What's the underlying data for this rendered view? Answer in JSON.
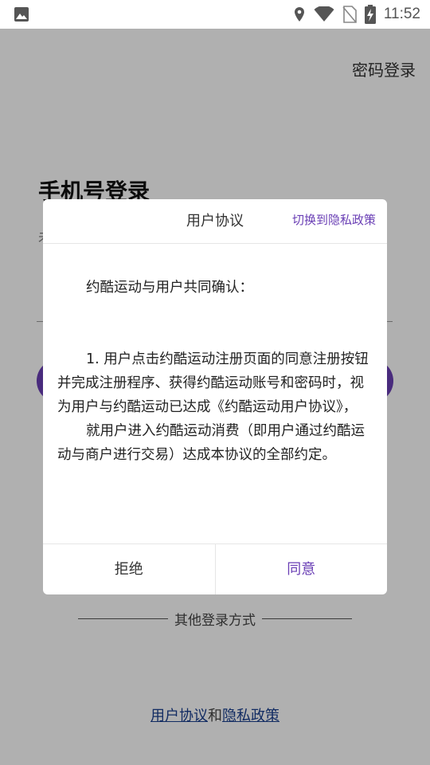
{
  "status_bar": {
    "time": "11:52",
    "icons": [
      "gallery-icon",
      "location-icon",
      "wifi-icon",
      "no-sim-icon",
      "battery-charging-icon"
    ]
  },
  "login": {
    "password_login": "密码登录",
    "title": "手机号登录",
    "subtitle_visible": "未",
    "other_methods": "其他登录方式",
    "agreement_user": "用户协议",
    "agreement_and": "和",
    "agreement_privacy": "隐私政策"
  },
  "colors": {
    "accent": "#6a3fb5",
    "link": "#1a3f8f"
  },
  "dialog": {
    "title": "用户协议",
    "switch_label": "切换到隐私政策",
    "confirm": "约酷运动与用户共同确认：",
    "paragraph1": "1. 用户点击约酷运动注册页面的同意注册按钮并完成注册程序、获得约酷运动账号和密码时，视为用户与约酷运动已达成《约酷运动用户协议》，",
    "paragraph2": "就用户进入约酷运动消费（即用户通过约酷运动与商户进行交易）达成本协议的全部约定。",
    "reject_label": "拒绝",
    "agree_label": "同意"
  }
}
